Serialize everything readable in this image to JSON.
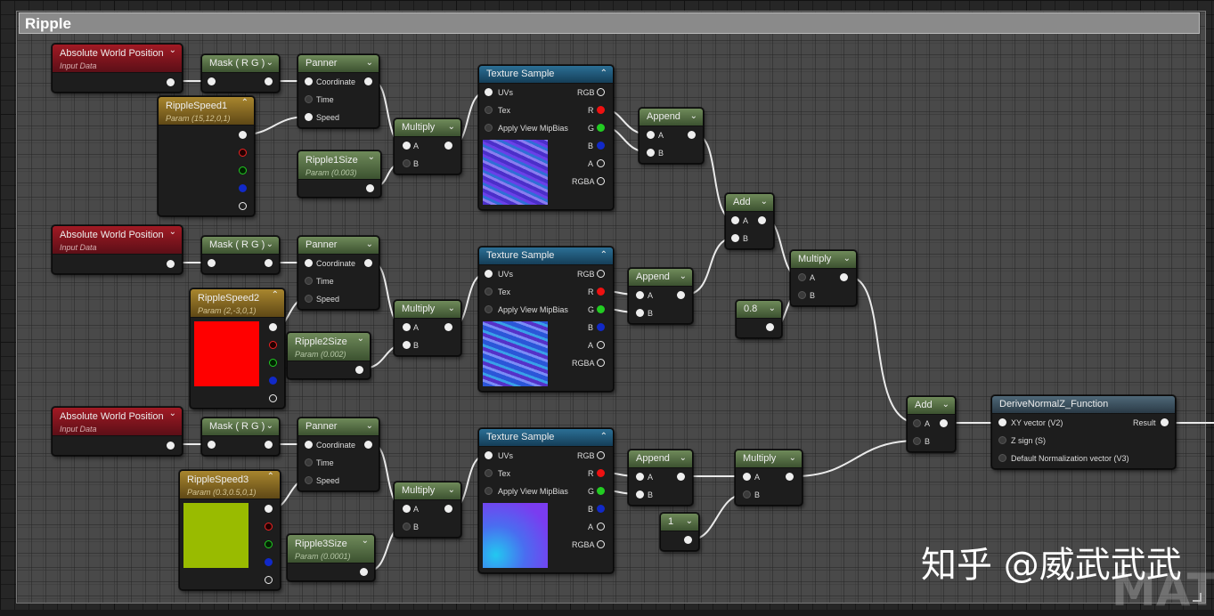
{
  "comment": {
    "title": "Ripple"
  },
  "nodes": {
    "awp": {
      "title": "Absolute World Position",
      "subtitle": "Input Data"
    },
    "mask": {
      "title": "Mask ( R G )"
    },
    "panner": {
      "title": "Panner",
      "coordinate": "Coordinate",
      "time": "Time",
      "speed": "Speed"
    },
    "multiply": {
      "title": "Multiply",
      "a": "A",
      "b": "B"
    },
    "texsample": {
      "title": "Texture Sample",
      "uvs": "UVs",
      "tex": "Tex",
      "mip": "Apply View MipBias",
      "rgb": "RGB",
      "r": "R",
      "g": "G",
      "b": "B",
      "a": "A",
      "rgba": "RGBA"
    },
    "append": {
      "title": "Append",
      "a": "A",
      "b": "B"
    },
    "add": {
      "title": "Add",
      "a": "A",
      "b": "B"
    },
    "speed1": {
      "title": "RippleSpeed1",
      "subtitle": "Param (15,12,0,1)"
    },
    "speed2": {
      "title": "RippleSpeed2",
      "subtitle": "Param (2,-3,0,1)"
    },
    "speed3": {
      "title": "RippleSpeed3",
      "subtitle": "Param (0.3,0.5,0,1)"
    },
    "size1": {
      "title": "Ripple1Size",
      "subtitle": "Param (0.003)"
    },
    "size2": {
      "title": "Ripple2Size",
      "subtitle": "Param (0.002)"
    },
    "size3": {
      "title": "Ripple3Size",
      "subtitle": "Param (0.0001)"
    },
    "const08": {
      "title": "0.8"
    },
    "const1": {
      "title": "1"
    },
    "derive": {
      "title": "DeriveNormalZ_Function",
      "xy": "XY vector (V2)",
      "zsign": "Z sign (S)",
      "def": "Default Normalization vector (V3)",
      "result": "Result"
    }
  },
  "colors": {
    "speed2_preview": "#ff0000",
    "speed3_preview": "#99bb00"
  },
  "watermark": {
    "text": "知乎 @威武武武",
    "faded": "MATI"
  }
}
